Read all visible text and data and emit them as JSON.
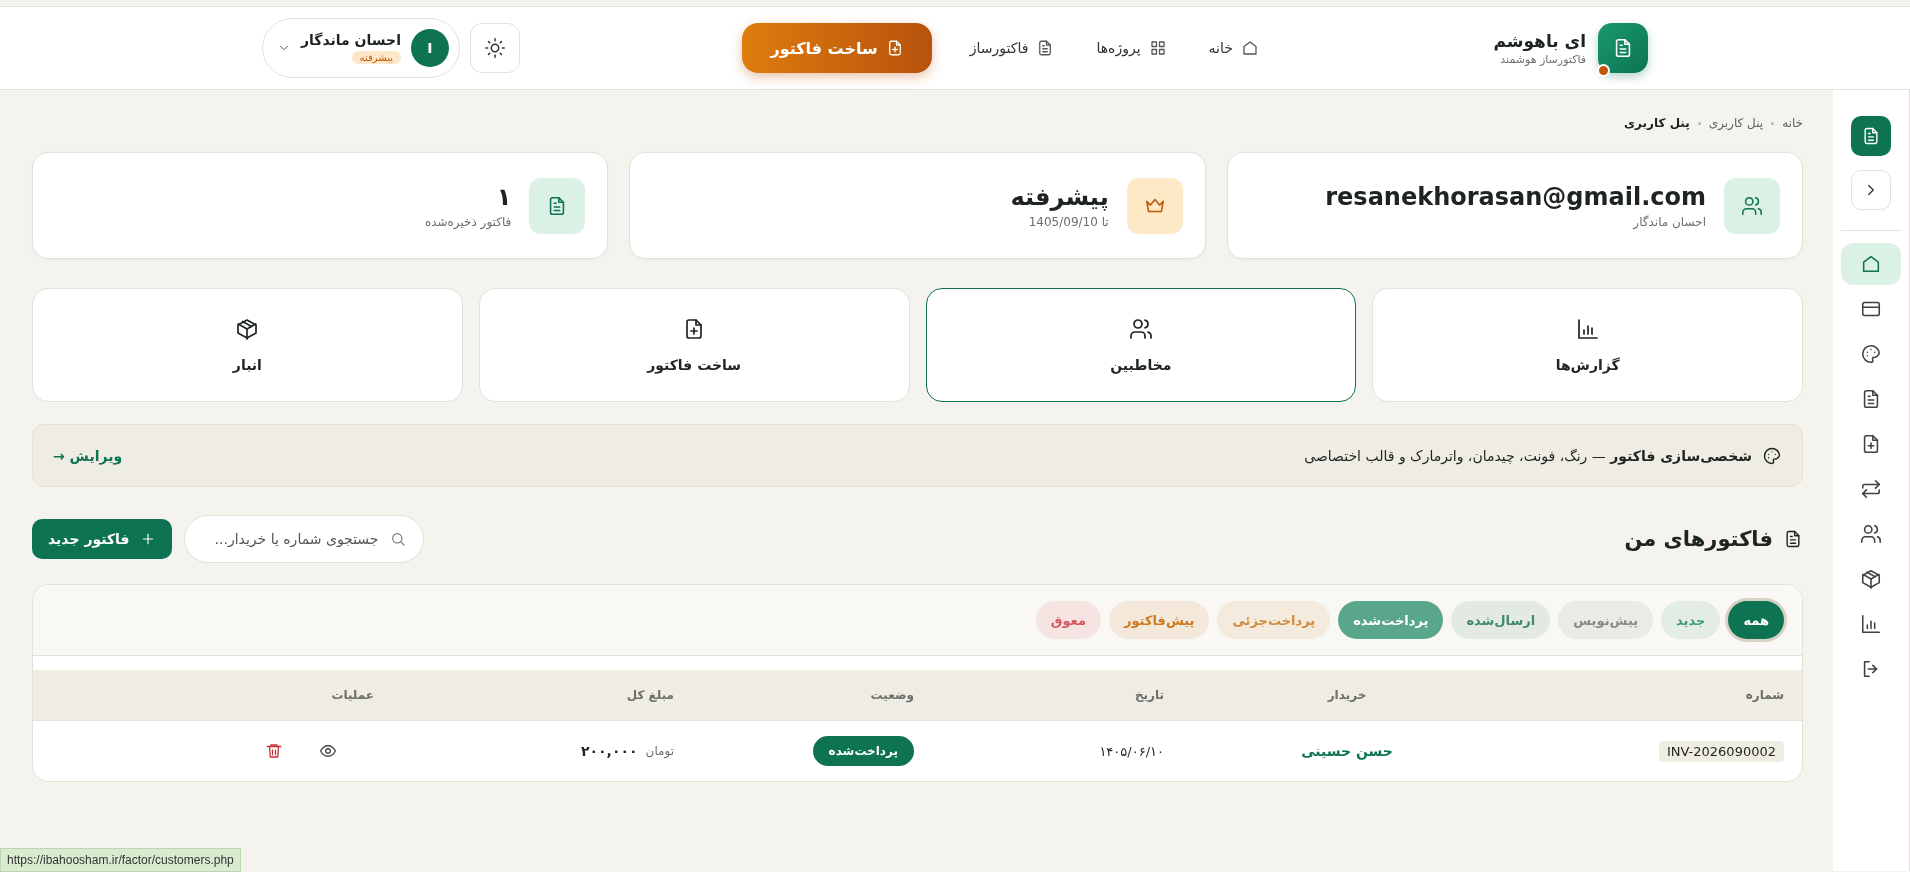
{
  "header": {
    "brand": {
      "title": "ای باهوشم",
      "subtitle": "فاکتورساز هوشمند"
    },
    "nav": [
      {
        "kind": "home",
        "label": "خانه"
      },
      {
        "kind": "grid",
        "label": "پروژه‌ها"
      },
      {
        "kind": "document",
        "label": "فاکتورساز"
      }
    ],
    "cta": "ساخت فاکتور",
    "user": {
      "initial": "I",
      "name": "احسان ماندگار",
      "plan": "پیشرفته"
    }
  },
  "sidebar": {
    "items": [
      {
        "kind": "home",
        "selected": true
      },
      {
        "kind": "card",
        "selected": false
      },
      {
        "kind": "palette",
        "selected": false
      },
      {
        "kind": "document",
        "selected": false
      },
      {
        "kind": "document-plus",
        "selected": false
      },
      {
        "kind": "swap",
        "selected": false
      },
      {
        "kind": "users",
        "selected": false
      },
      {
        "kind": "box",
        "selected": false
      },
      {
        "kind": "chart",
        "selected": false
      },
      {
        "kind": "logout",
        "selected": false
      }
    ]
  },
  "breadcrumb": [
    {
      "label": "خانه",
      "current": false
    },
    {
      "label": "پنل کاربری",
      "current": false
    },
    {
      "label": "پنل کاربری",
      "current": true
    }
  ],
  "stats": [
    {
      "kind": "users",
      "value": "resanekhorasan@gmail.com",
      "caption": "احسان ماندگار"
    },
    {
      "kind": "crown",
      "value": "پیشرفته",
      "caption": "تا 1405/09/10"
    },
    {
      "kind": "document",
      "value": "۱",
      "caption": "فاکتور ذخیره‌شده"
    }
  ],
  "shortcuts": [
    {
      "kind": "chart",
      "label": "گزارش‌ها",
      "selected": false
    },
    {
      "kind": "users",
      "label": "مخاطبین",
      "selected": true
    },
    {
      "kind": "document-plus",
      "label": "ساخت فاکتور",
      "selected": false
    },
    {
      "kind": "box",
      "label": "انبار",
      "selected": false
    }
  ],
  "banner": {
    "text": "**شخصی‌سازی فاکتور** — رنگ، فونت، چیدمان، واترمارک و قالب اختصاصی",
    "link": "ویرایش →"
  },
  "invoices": {
    "title": "فاکتورهای من",
    "search": {
      "placeholder": "جستجوی شماره یا خریدار..."
    },
    "new_button": "فاکتور جدید",
    "filters": [
      {
        "label": "همه",
        "selected": true,
        "kind": "soft",
        "color": "#0d7352"
      },
      {
        "label": "جدید",
        "selected": false,
        "kind": "soft",
        "color": "#3f9a78"
      },
      {
        "label": "پیش‌نویس",
        "selected": false,
        "kind": "soft",
        "color": "#8a8a85"
      },
      {
        "label": "ارسال‌شده",
        "selected": false,
        "kind": "soft",
        "color": "#3f8a6c"
      },
      {
        "label": "پرداخت‌شده",
        "selected": false,
        "kind": "solid",
        "color": "#5aa68a"
      },
      {
        "label": "پرداخت‌جزئی",
        "selected": false,
        "kind": "soft",
        "color": "#d08a3c"
      },
      {
        "label": "پیش‌فاکتور",
        "selected": false,
        "kind": "soft",
        "color": "#cc7a1e"
      },
      {
        "label": "معوق",
        "selected": false,
        "kind": "soft",
        "color": "#d9575e"
      }
    ],
    "columns": [
      "شماره",
      "خریدار",
      "تاریخ",
      "وضعیت",
      "مبلغ کل",
      "عملیات"
    ],
    "rows": [
      {
        "number": "INV-2026090002",
        "buyer": "حسن حسینی",
        "date": "۱۴۰۵/۰۶/۱۰",
        "status": "پرداخت‌شده",
        "currency": "تومان",
        "amount": "۲۰۰,۰۰۰"
      }
    ]
  },
  "status_bar": "https://ibahoosham.ir/factor/customers.php"
}
